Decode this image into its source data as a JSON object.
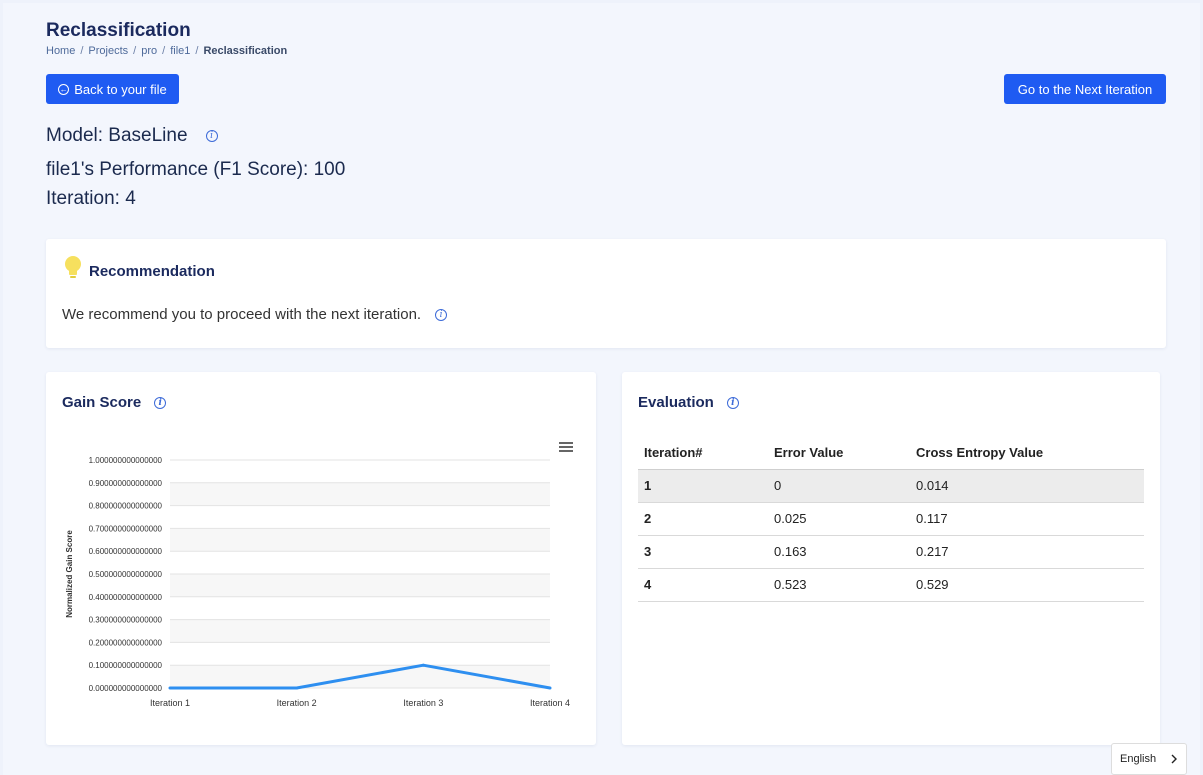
{
  "page": {
    "title": "Reclassification",
    "breadcrumb": [
      "Home",
      "Projects",
      "pro",
      "file1",
      "Reclassification"
    ]
  },
  "buttons": {
    "back_label": "Back to your file",
    "next_label": "Go to the Next Iteration"
  },
  "model": {
    "model_line": "Model: BaseLine",
    "performance_line": "file1's Performance (F1 Score): 100",
    "iteration_line": "Iteration: 4"
  },
  "recommendation": {
    "title": "Recommendation",
    "text": "We recommend you to proceed with the next iteration."
  },
  "gain_score": {
    "title": "Gain Score"
  },
  "chart_data": {
    "type": "line",
    "title": "",
    "xlabel": "",
    "ylabel": "Normalized Gain Score",
    "categories": [
      "Iteration 1",
      "Iteration 2",
      "Iteration 3",
      "Iteration 4"
    ],
    "series": [
      {
        "values": [
          0,
          0,
          0.1,
          0
        ]
      }
    ],
    "ylim": [
      0,
      1
    ],
    "yticks": [
      "0.000000000000000",
      "0.100000000000000",
      "0.200000000000000",
      "0.300000000000000",
      "0.400000000000000",
      "0.500000000000000",
      "0.600000000000000",
      "0.700000000000000",
      "0.800000000000000",
      "0.900000000000000",
      "1.000000000000000"
    ],
    "grid": true,
    "colors": {
      "line": "#2e8ff0"
    }
  },
  "evaluation": {
    "title": "Evaluation",
    "headers": [
      "Iteration#",
      "Error Value",
      "Cross Entropy Value"
    ],
    "rows": [
      [
        "1",
        "0",
        "0.014"
      ],
      [
        "2",
        "0.025",
        "0.117"
      ],
      [
        "3",
        "0.163",
        "0.217"
      ],
      [
        "4",
        "0.523",
        "0.529"
      ]
    ]
  },
  "language": {
    "label": "English",
    "icon": "chevron-right-icon"
  },
  "colors": {
    "primary": "#1f5bf2",
    "heading": "#1b2a5e",
    "bulb": "#f6e05e"
  }
}
